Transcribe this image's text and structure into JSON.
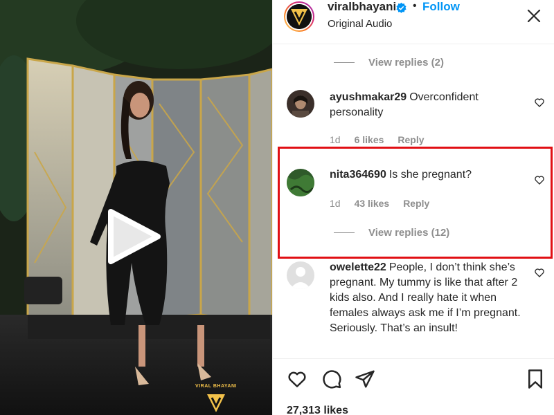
{
  "post": {
    "username": "viralbhayani",
    "follow_label": "Follow",
    "separator": "•",
    "subtitle": "Original Audio",
    "likes_count": "27,313 likes"
  },
  "video": {
    "watermark_text": "VIRAL BHAYANI",
    "icons": {
      "play": "play-icon",
      "logo": "viral-bhayani-logo"
    }
  },
  "comments": {
    "top_view_replies": "View replies (2)",
    "items": [
      {
        "username": "ayushmakar29",
        "text": "Overconfident personality",
        "time": "1d",
        "likes": "6 likes",
        "reply": "Reply"
      },
      {
        "username": "nita364690",
        "text": "Is she pregnant?",
        "time": "1d",
        "likes": "43 likes",
        "reply": "Reply",
        "view_replies": "View replies (12)",
        "highlighted": true
      },
      {
        "username": "owelette22",
        "text": "People, I don’t think she’s pregnant. My tummy is like that after 2 kids also. And I really hate it when females always ask me if I’m pregnant. Seriously. That’s an insult!"
      }
    ]
  },
  "colors": {
    "follow": "#0095f6",
    "highlight": "#e10f14",
    "muted": "#8e8e8e",
    "verified": "#0095f6"
  },
  "icons": {
    "verified": "verified-badge-icon",
    "more": "more-options-icon",
    "heart": "heart-icon",
    "comment": "comment-icon",
    "share": "share-icon",
    "save": "bookmark-icon"
  }
}
